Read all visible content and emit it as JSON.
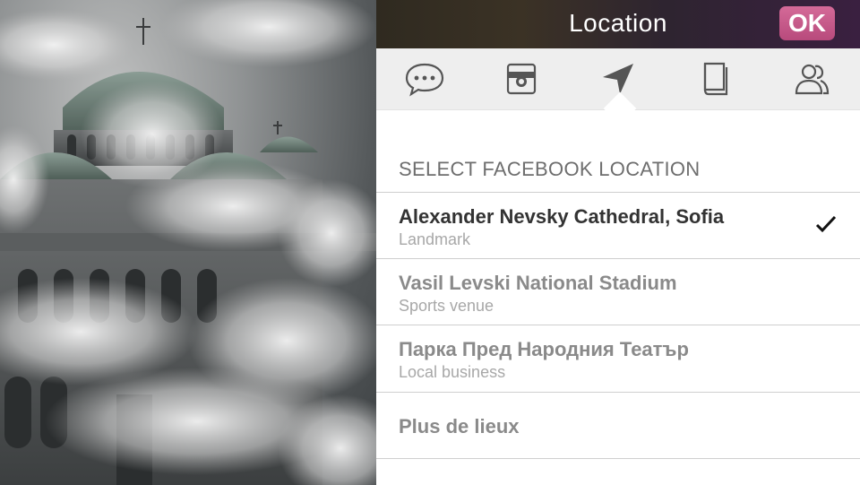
{
  "header": {
    "title": "Location",
    "ok_label": "OK"
  },
  "tabs": [
    {
      "icon": "speech-bubble-icon",
      "selected": false
    },
    {
      "icon": "photo-frame-icon",
      "selected": false
    },
    {
      "icon": "location-arrow-icon",
      "selected": true
    },
    {
      "icon": "notebook-icon",
      "selected": false
    },
    {
      "icon": "people-icon",
      "selected": false
    }
  ],
  "section": {
    "header": "SELECT FACEBOOK LOCATION"
  },
  "locations": [
    {
      "name": "Alexander Nevsky Cathedral, Sofia",
      "category": "Landmark",
      "selected": true
    },
    {
      "name": "Vasil Levski National Stadium",
      "category": "Sports venue",
      "selected": false
    },
    {
      "name": "Парка Пред Народния Театър",
      "category": "Local business",
      "selected": false
    }
  ],
  "more_label": "Plus de lieux",
  "colors": {
    "accent": "#c2578a",
    "text_selected": "#333333",
    "text_muted": "#8a8a8a"
  }
}
